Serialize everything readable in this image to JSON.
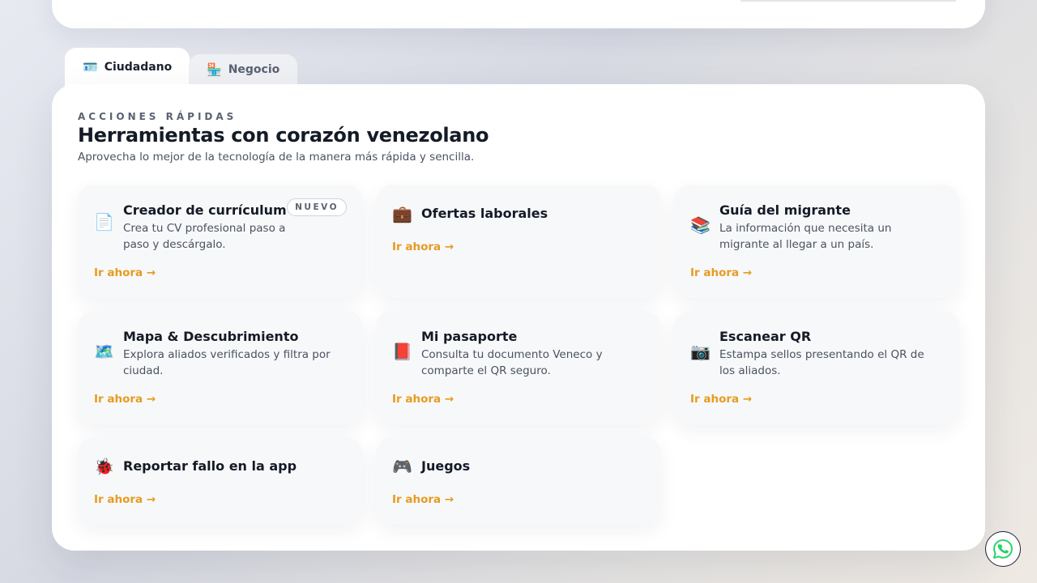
{
  "tabs": [
    {
      "label": "Ciudadano",
      "icon": "🪪"
    },
    {
      "label": "Negocio",
      "icon": "🏪"
    }
  ],
  "section": {
    "eyebrow": "ACCIONES RÁPIDAS",
    "title": "Herramientas con corazón venezolano",
    "subtitle": "Aprovecha lo mejor de la tecnología de la manera más rápida y sencilla."
  },
  "tiles": [
    {
      "icon": "📄",
      "title": "Creador de currículum",
      "desc": "Crea tu CV profesional paso a paso y descárgalo.",
      "cta": "Ir ahora →",
      "badge": "NUEVO"
    },
    {
      "icon": "💼",
      "title": "Ofertas laborales",
      "desc": "",
      "cta": "Ir ahora →"
    },
    {
      "icon": "📚",
      "title": "Guía del migrante",
      "desc": "La información que necesita un migrante al llegar a un país.",
      "cta": "Ir ahora →"
    },
    {
      "icon": "🗺️",
      "title": "Mapa & Descubrimiento",
      "desc": "Explora aliados verificados y filtra por ciudad.",
      "cta": "Ir ahora →"
    },
    {
      "icon": "📕",
      "title": "Mi pasaporte",
      "desc": "Consulta tu documento Veneco y comparte el QR seguro.",
      "cta": "Ir ahora →"
    },
    {
      "icon": "📷",
      "title": "Escanear QR",
      "desc": "Estampa sellos presentando el QR de los aliados.",
      "cta": "Ir ahora →"
    },
    {
      "icon": "🐞",
      "title": "Reportar fallo en la app",
      "desc": "",
      "cta": "Ir ahora →"
    },
    {
      "icon": "🎮",
      "title": "Juegos",
      "desc": "",
      "cta": "Ir ahora →"
    }
  ],
  "colors": {
    "accent": "#e79b1f",
    "whatsapp": "#25d366"
  },
  "floating": {
    "icon": "whatsapp-icon"
  }
}
